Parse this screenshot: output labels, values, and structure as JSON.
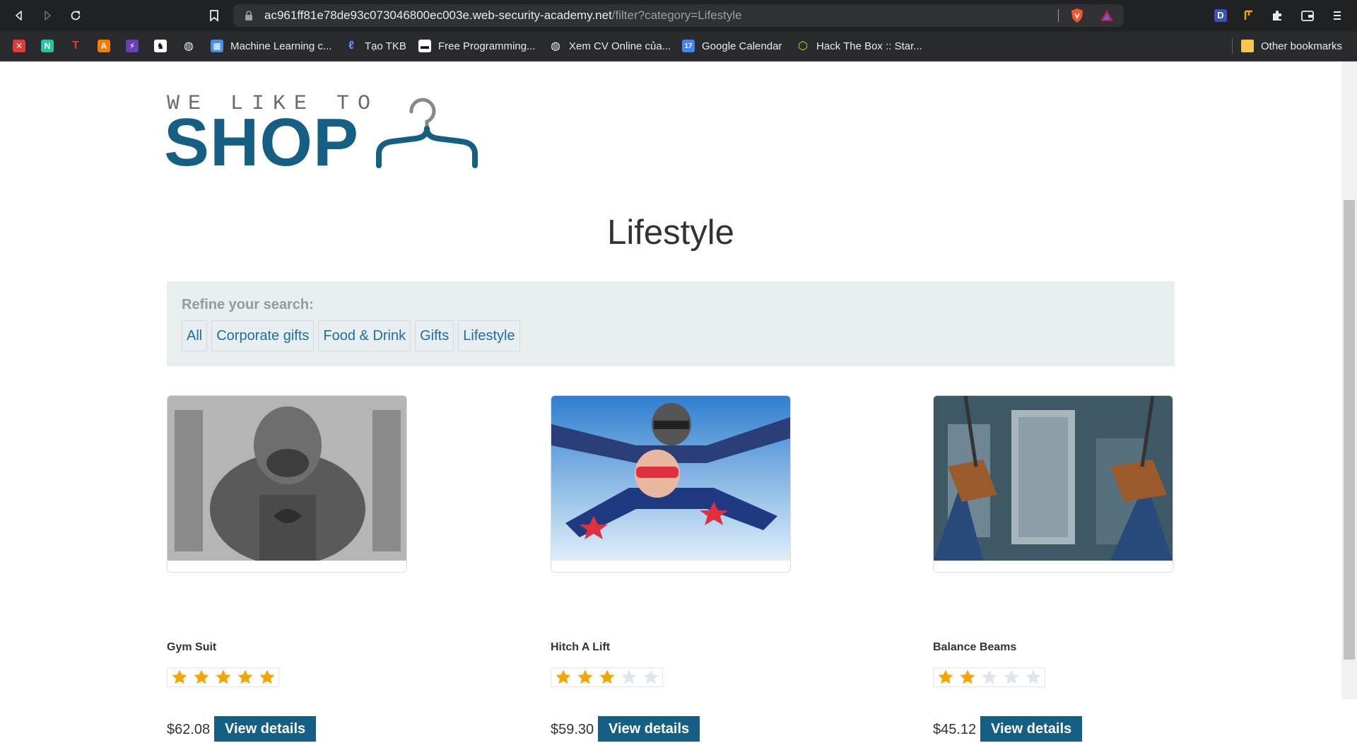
{
  "browser": {
    "url_host": "ac961ff81e78de93c073046800ec003e.web-security-academy.net",
    "url_path": "/filter?category=Lifestyle",
    "bookmarks": [
      {
        "label": "Machine Learning c...",
        "icon": "ml-bookmark-icon",
        "color": "#4a90e2"
      },
      {
        "label": "Tạo TKB",
        "icon": "tkb-bookmark-icon",
        "color": "#3b5bdb"
      },
      {
        "label": "Free Programming...",
        "icon": "free-programming-bookmark-icon",
        "color": "#111111"
      },
      {
        "label": "Xem CV Online của...",
        "icon": "globe-icon",
        "color": "#e8eaed"
      },
      {
        "label": "Google Calendar",
        "icon": "google-calendar-icon",
        "color": "#4285f4"
      },
      {
        "label": "Hack The Box :: Star...",
        "icon": "hackthebox-icon",
        "color": "#9fef00"
      }
    ],
    "other_bookmarks": "Other bookmarks"
  },
  "logo": {
    "top_text": "WE LIKE TO",
    "shop_text": "SHOP"
  },
  "page": {
    "title": "Lifestyle",
    "refine_label": "Refine your search:",
    "filters": [
      "All",
      "Corporate gifts",
      "Food & Drink",
      "Gifts",
      "Lifestyle"
    ]
  },
  "products": [
    {
      "name": "Gym Suit",
      "rating": 5,
      "price": "$62.08",
      "button": "View details"
    },
    {
      "name": "Hitch A Lift",
      "rating": 3,
      "price": "$59.30",
      "button": "View details"
    },
    {
      "name": "Balance Beams",
      "rating": 2,
      "price": "$45.12",
      "button": "View details"
    }
  ],
  "colors": {
    "brand": "#155f84",
    "star_filled": "#f5a400",
    "star_empty": "#dfe6ea"
  }
}
